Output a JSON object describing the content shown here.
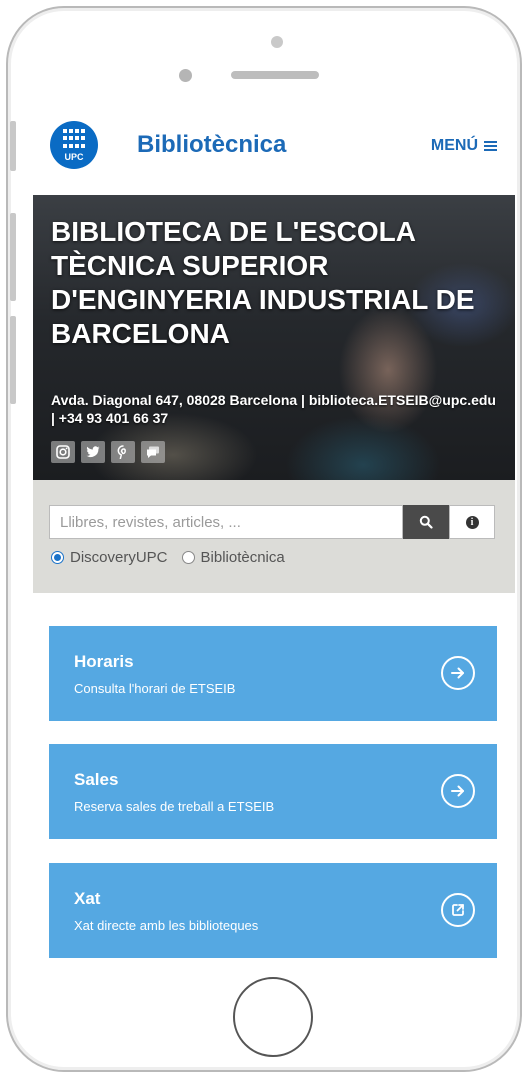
{
  "header": {
    "logo_text": "UPC",
    "brand": "Bibliotècnica",
    "menu_label": "MENÚ"
  },
  "hero": {
    "title": "BIBLIOTECA DE L'ESCOLA TÈCNICA SUPERIOR D'ENGINYERIA INDUSTRIAL DE BARCELONA",
    "contact": "Avda. Diagonal 647, 08028 Barcelona | biblioteca.ETSEIB@upc.edu | +34 93 401 66 37",
    "social_icons": [
      "instagram-icon",
      "twitter-icon",
      "pinterest-icon",
      "chat-icon"
    ]
  },
  "search": {
    "placeholder": "Llibres, revistes, articles, ...",
    "value": "",
    "options": [
      "DiscoveryUPC",
      "Bibliotècnica"
    ],
    "selected": "DiscoveryUPC"
  },
  "cards": [
    {
      "title": "Horaris",
      "subtitle": "Consulta l'horari de ETSEIB",
      "icon": "arrow-right-icon"
    },
    {
      "title": "Sales",
      "subtitle": "Reserva sales de treball a ETSEIB",
      "icon": "arrow-right-icon"
    },
    {
      "title": "Xat",
      "subtitle": "Xat directe amb les biblioteques",
      "icon": "external-link-icon"
    }
  ],
  "colors": {
    "brand_blue": "#1c6ab7",
    "logo_blue": "#0a6bc4",
    "card_blue": "#55a8e2",
    "search_bg": "#dcdcd8",
    "search_button": "#4a4a4a"
  }
}
